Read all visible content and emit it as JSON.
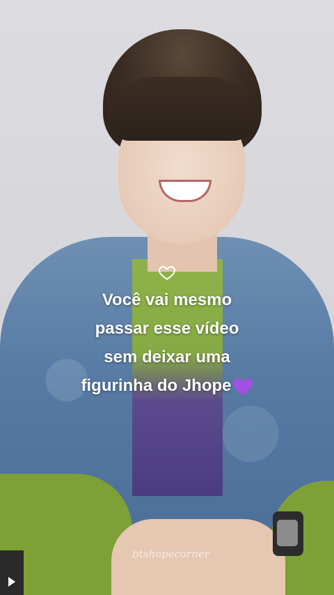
{
  "overlay": {
    "lines": [
      "Você vai mesmo",
      "passar esse vídeo",
      "sem deixar uma",
      "figurinha do Jhope"
    ],
    "heart_icon": "outline-heart-icon",
    "purple_heart_icon": "purple-heart-icon",
    "purple_heart_color": "#a24fe3"
  },
  "watermark": {
    "text": "btshopecorner"
  },
  "player": {
    "play_icon": "play-icon"
  }
}
